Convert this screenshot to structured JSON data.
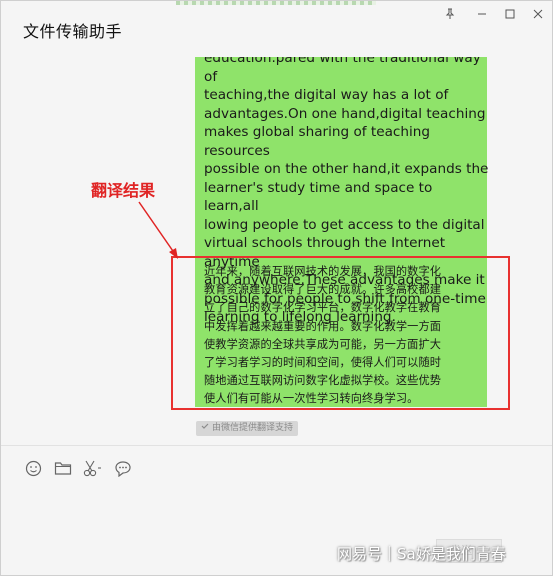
{
  "window": {
    "title": "文件传输助手"
  },
  "chat": {
    "message_text": "education.pared with the traditional way of\nteaching,the digital way has a lot of\nadvantages.On one hand,digital teaching\nmakes global sharing of teaching resources\npossible on the other hand,it expands the\nlearner's study time and space to learn,all\nlowing people to get access to the digital\nvirtual schools through the Internet anytime\nand anywhere.These advantages make it\npossible for people to shift from one-time\nlearning to lifelong learning.",
    "translation_text": "近年来，随着互联网技术的发展，我国的数字化\n教育资源建设取得了巨大的成就。许多高校都建\n立了自己的数字化学习平台，数字化教学在教育\n中发挥着越来越重要的作用。数字化教学一方面\n使教学资源的全球共享成为可能，另一方面扩大\n了学习者学习的时间和空间，使得人们可以随时\n随地通过互联网访问数字化虚拟学校。这些优势\n使人们有可能从一次性学习转向终身学习。",
    "translation_badge": "由微信提供翻译支持",
    "bubble_color": "#8fe36a"
  },
  "annotation": {
    "label": "翻译结果",
    "color": "#e02424"
  },
  "toolbar": {
    "icons": [
      "emoji-icon",
      "folder-icon",
      "scissors-icon",
      "chat-bubble-icon"
    ]
  },
  "input": {
    "send_label": "发送(S)"
  },
  "watermark": {
    "text": "网易号｜Sa娇是我们青春"
  }
}
